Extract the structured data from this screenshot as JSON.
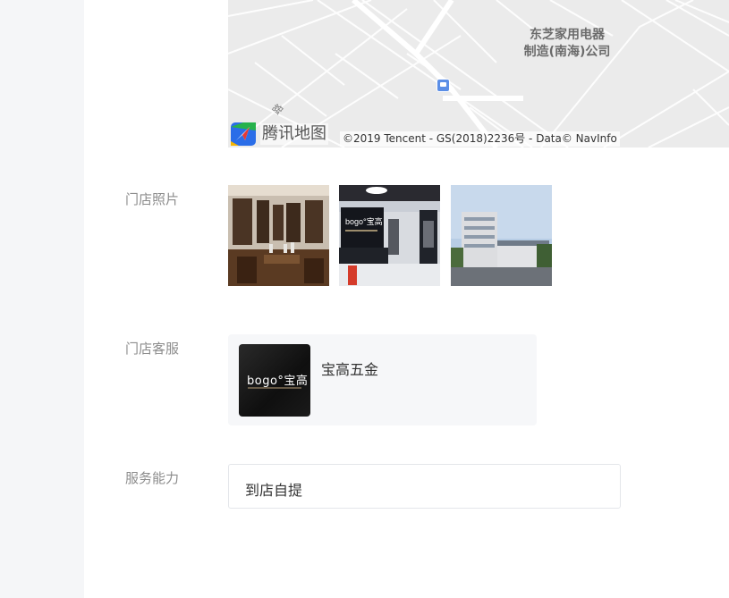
{
  "map": {
    "poi_name_line1": "东芝家用电器",
    "poi_name_line2": "制造(南海)公司",
    "road_label": "路",
    "logo_text": "腾讯地图",
    "copyright": "©2019 Tencent - GS(2018)2236号 - Data© NavInfo",
    "logo_icon": "tencent-map-logo",
    "bus_icon": "bus-stop-icon"
  },
  "store_photos": {
    "label": "门店照片",
    "photos": [
      {
        "alt": "门店照片1"
      },
      {
        "alt": "门店照片2"
      },
      {
        "alt": "门店照片3"
      }
    ]
  },
  "customer_service": {
    "label": "门店客服",
    "avatar_brand": "bogo°宝高",
    "name": "宝高五金"
  },
  "service_ability": {
    "label": "服务能力",
    "value": "到店自提"
  },
  "colors": {
    "page_background": "#f5f6f8",
    "panel_background": "#ffffff",
    "label_gray": "#8c8c8c",
    "map_background": "#ebebeb",
    "bus_icon_blue": "#5b8ee6"
  }
}
